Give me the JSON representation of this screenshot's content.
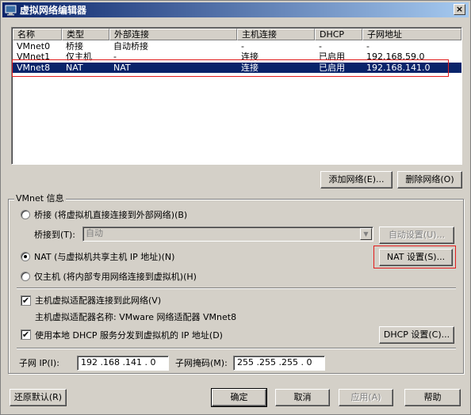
{
  "window": {
    "title": "虚拟网络编辑器",
    "close_label": "×"
  },
  "table": {
    "headers": [
      "名称",
      "类型",
      "外部连接",
      "主机连接",
      "DHCP",
      "子网地址"
    ],
    "rows": [
      [
        "VMnet0",
        "桥接",
        "自动桥接",
        "-",
        "-",
        "-"
      ],
      [
        "VMnet1",
        "仅主机",
        "-",
        "连接",
        "已启用",
        "192.168.59.0"
      ],
      [
        "VMnet8",
        "NAT",
        "NAT",
        "连接",
        "已启用",
        "192.168.141.0"
      ]
    ],
    "selected_row": 2
  },
  "list_buttons": {
    "add": "添加网络(E)...",
    "remove": "删除网络(O)"
  },
  "vmnet_info": {
    "group_label": "VMnet 信息",
    "bridge_radio": "桥接 (将虚拟机直接连接到外部网络)(B)",
    "bridge_to_label": "桥接到(T):",
    "bridge_to_value": "自动",
    "auto_settings": "自动设置(U)...",
    "nat_radio": "NAT (与虚拟机共享主机 IP 地址)(N)",
    "nat_settings": "NAT 设置(S)...",
    "hostonly_radio": "仅主机 (将内部专用网络连接到虚拟机)(H)",
    "connect_adapter": "主机虚拟适配器连接到此网络(V)",
    "adapter_name": "主机虚拟适配器名称: VMware 网络适配器 VMnet8",
    "use_dhcp": "使用本地 DHCP 服务分发到虚拟机的 IP 地址(D)",
    "dhcp_settings": "DHCP 设置(C)...",
    "subnet_ip_label": "子网 IP(I):",
    "subnet_ip": "192 .168 .141 . 0",
    "subnet_mask_label": "子网掩码(M):",
    "subnet_mask": "255 .255 .255 . 0"
  },
  "footer": {
    "restore": "还原默认(R)",
    "ok": "确定",
    "cancel": "取消",
    "apply": "应用(A)",
    "help": "帮助"
  },
  "colors": {
    "selection": "#0a246a",
    "highlight_box": "#e21c1c",
    "title_gradient_start": "#0a246a"
  },
  "icons": {
    "title_icon": "network-editor-icon",
    "close_icon": "close-icon",
    "check_mark": "✔"
  }
}
